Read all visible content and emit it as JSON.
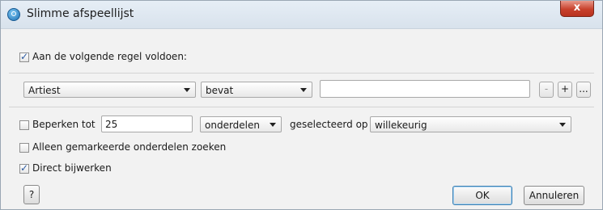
{
  "window": {
    "title": "Slimme afspeellijst",
    "close_label": "x"
  },
  "match_rule": {
    "label": "Aan de volgende regel voldoen:",
    "checked": true
  },
  "rule": {
    "field": "Artiest",
    "operator": "bevat",
    "value": "",
    "remove_label": "-",
    "add_label": "+",
    "more_label": "..."
  },
  "limit": {
    "label": "Beperken tot",
    "checked": false,
    "amount": "25",
    "unit": "onderdelen",
    "selected_by_label": "geselecteerd op",
    "selected_by": "willekeurig"
  },
  "only_checked": {
    "label": "Alleen gemarkeerde onderdelen zoeken",
    "checked": false
  },
  "live_update": {
    "label": "Direct bijwerken",
    "checked": true
  },
  "buttons": {
    "help": "?",
    "ok": "OK",
    "cancel": "Annuleren"
  }
}
